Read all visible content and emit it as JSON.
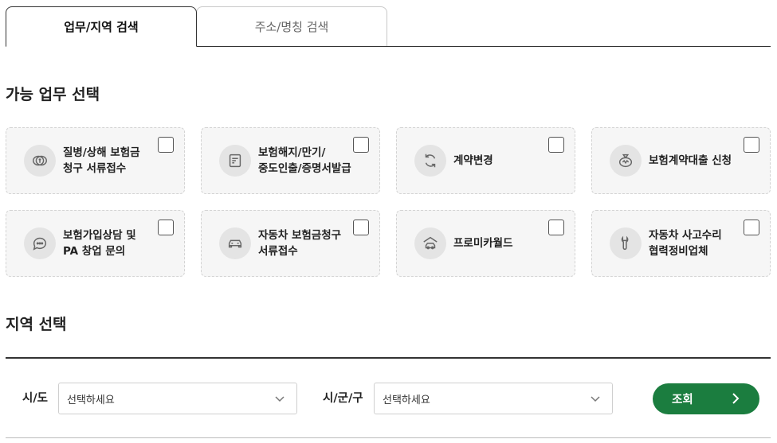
{
  "tabs": [
    {
      "label": "업무/지역 검색",
      "active": true
    },
    {
      "label": "주소/명칭 검색",
      "active": false
    }
  ],
  "sections": {
    "service_title": "가능 업무 선택",
    "region_title": "지역 선택"
  },
  "services": [
    {
      "label": "질병/상해 보험금\n청구 서류접수",
      "icon": "coins-icon"
    },
    {
      "label": "보험해지/만기/\n중도인출/증명서발급",
      "icon": "document-icon"
    },
    {
      "label": "계약변경",
      "icon": "refresh-icon"
    },
    {
      "label": "보험계약대출 신청",
      "icon": "money-bag-icon"
    },
    {
      "label": "보험가입상담 및\nPA 창업 문의",
      "icon": "chat-icon"
    },
    {
      "label": "자동차 보험금청구\n서류접수",
      "icon": "car-icon"
    },
    {
      "label": "프로미카월드",
      "icon": "car-garage-icon"
    },
    {
      "label": "자동차 사고수리\n협력정비업체",
      "icon": "wrench-icon"
    }
  ],
  "region": {
    "sido_label": "시/도",
    "sido_value": "선택하세요",
    "sigungu_label": "시/군/구",
    "sigungu_value": "선택하세요",
    "search_label": "조회"
  },
  "colors": {
    "accent": "#1b7d3f",
    "card_bg": "#f6f6f6",
    "icon_bg": "#e4e4e4"
  }
}
